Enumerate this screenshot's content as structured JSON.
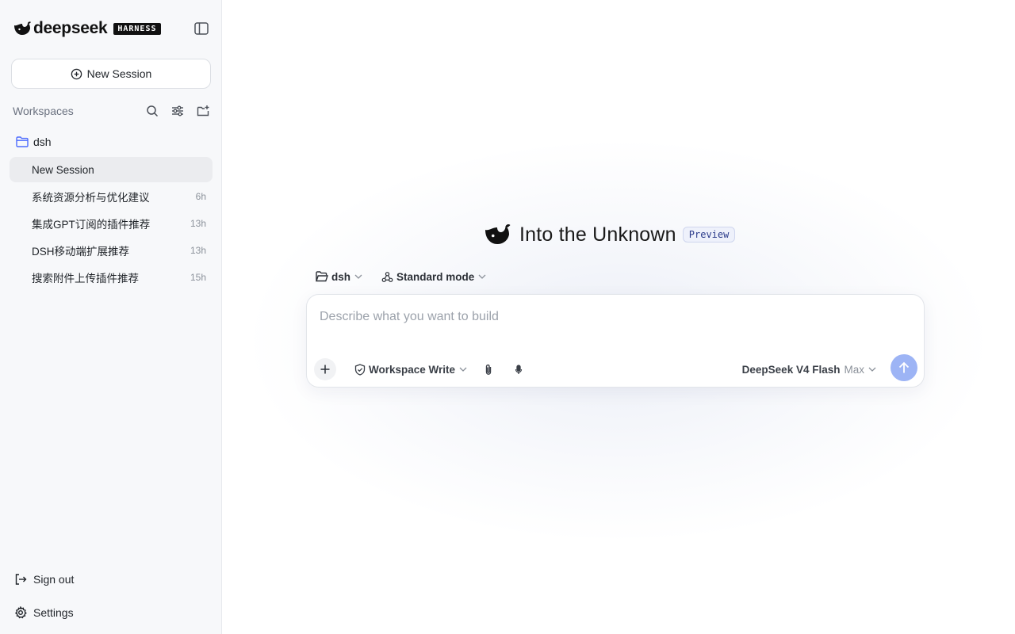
{
  "brand": {
    "name": "deepseek",
    "badge": "HARNESS"
  },
  "sidebar": {
    "new_session_label": "New Session",
    "workspaces_label": "Workspaces",
    "workspace": {
      "name": "dsh",
      "sessions": [
        {
          "title": "New Session",
          "time": "",
          "active": true
        },
        {
          "title": "系统资源分析与优化建议",
          "time": "6h",
          "active": false
        },
        {
          "title": "集成GPT订阅的插件推荐",
          "time": "13h",
          "active": false
        },
        {
          "title": "DSH移动端扩展推荐",
          "time": "13h",
          "active": false
        },
        {
          "title": "搜索附件上传插件推荐",
          "time": "15h",
          "active": false
        }
      ]
    },
    "sign_out_label": "Sign out",
    "settings_label": "Settings"
  },
  "main": {
    "hero_title": "Into the Unknown",
    "preview_badge": "Preview",
    "context": {
      "workspace": "dsh",
      "mode": "Standard mode"
    },
    "composer": {
      "placeholder": "Describe what you want to build",
      "permission": "Workspace Write",
      "model": "DeepSeek V4 Flash",
      "model_tier": "Max"
    }
  },
  "colors": {
    "accent": "#4d6bfe",
    "send_button": "#9db4f5",
    "sidebar_bg": "#f7f8fa",
    "active_item_bg": "#ebecef",
    "preview_badge_text": "#2a3a8a",
    "folder_icon": "#4d6bfe"
  },
  "icons": {
    "collapse": "sidebar-toggle-icon",
    "new_session": "plus-circle-icon",
    "search": "search-icon",
    "filter": "sliders-icon",
    "add_folder": "folder-plus-icon",
    "folder": "folder-icon",
    "sign_out": "log-out-icon",
    "settings": "gear-icon",
    "attach": "paperclip-icon",
    "mic": "microphone-icon",
    "send": "arrow-up-icon"
  }
}
